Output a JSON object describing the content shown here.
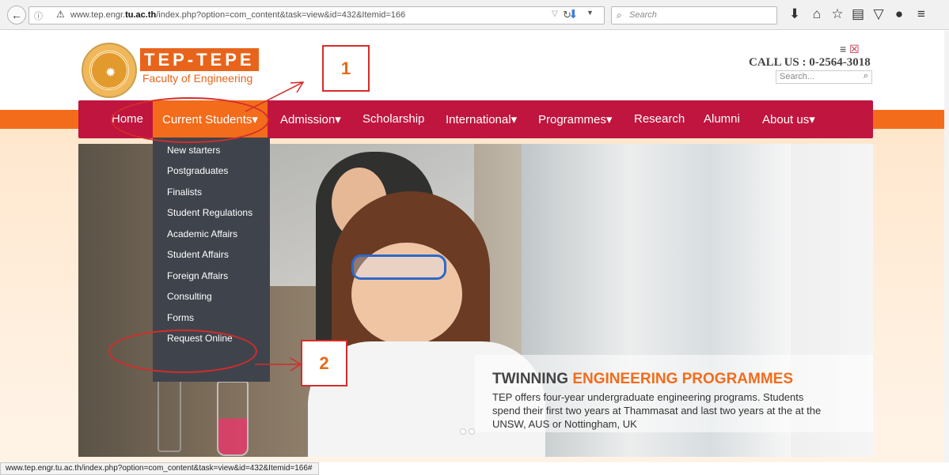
{
  "browser": {
    "url_prefix": "www.tep.engr.",
    "url_domain": "tu.ac.th",
    "url_suffix": "/index.php?option=com_content&task=view&id=432&Itemid=166",
    "search_placeholder": "Search",
    "status_url": "www.tep.engr.tu.ac.th/index.php?option=com_content&task=view&id=432&Itemid=166#"
  },
  "site": {
    "brand": "TEP-TEPE",
    "faculty": "Faculty of Engineering",
    "call_us": "CALL US : 0-2564-3018",
    "search_placeholder": "Search...",
    "accent_color": "#f26c1c",
    "menu_color": "#c0153e"
  },
  "menu": {
    "home": "Home",
    "current_students": "Current Students",
    "admission": "Admission",
    "scholarship": "Scholarship",
    "international": "International",
    "programmes": "Programmes",
    "research": "Research",
    "alumni": "Alumni",
    "about_us": "About us",
    "caret": "▾"
  },
  "dropdown": {
    "items": [
      "New starters",
      "Postgraduates",
      "Finalists",
      "Student Regulations",
      "Academic Affairs",
      "Student Affairs",
      "Foreign Affairs",
      "Consulting",
      "Forms",
      "Request Online"
    ]
  },
  "hero": {
    "title_a": "TWINNING ",
    "title_b": "ENGINEERING PROGRAMMES",
    "text": "TEP offers four-year undergraduate engineering programs. Students spend their first two years at Thammasat and last two years at the at the UNSW, AUS or Nottingham, UK"
  },
  "annotations": {
    "label_1": "1",
    "label_2": "2"
  }
}
